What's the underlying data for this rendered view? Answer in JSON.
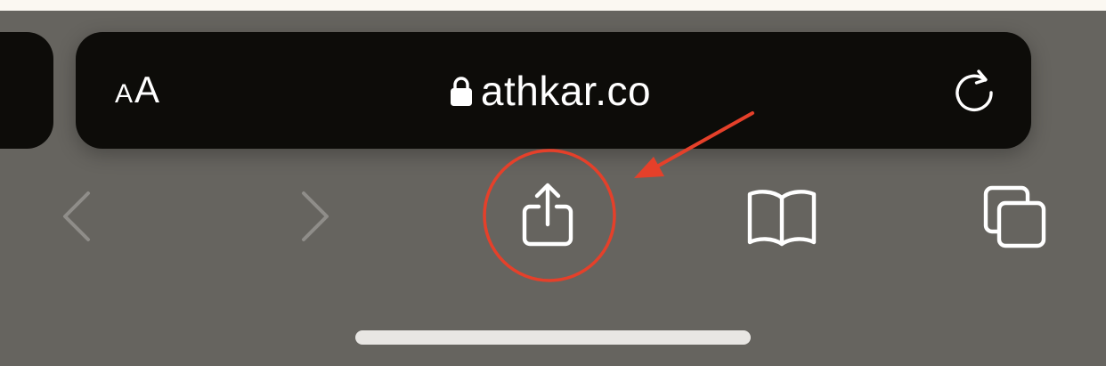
{
  "address_bar": {
    "text_size_small": "A",
    "text_size_large": "A",
    "url": "athkar.co",
    "lock_icon": "lock-icon",
    "reload_icon": "reload-icon"
  },
  "toolbar": {
    "buttons": [
      {
        "icon": "chevron-left-icon",
        "enabled": false
      },
      {
        "icon": "chevron-right-icon",
        "enabled": false
      },
      {
        "icon": "share-icon",
        "enabled": true,
        "highlighted": true
      },
      {
        "icon": "book-icon",
        "enabled": true
      },
      {
        "icon": "tabs-icon",
        "enabled": true
      }
    ]
  },
  "annotation": {
    "type": "red circle with arrow pointing to share button",
    "color": "#e5402a"
  },
  "colors": {
    "background": "#66645f",
    "address_bar": "#0d0c09",
    "icon_active": "#ffffff",
    "icon_disabled": "#8f8d89",
    "top_strip": "#fbf8f2"
  }
}
